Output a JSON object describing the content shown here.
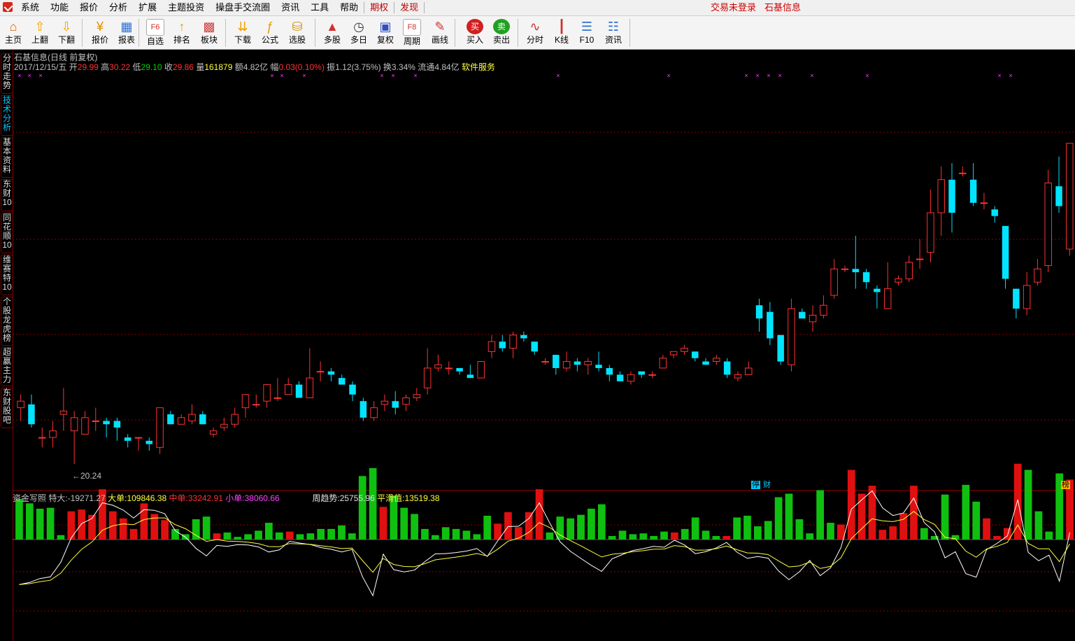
{
  "menubar": {
    "items": [
      "系统",
      "功能",
      "报价",
      "分析",
      "扩展",
      "主题投资",
      "操盘手交流圈",
      "资讯",
      "工具",
      "帮助"
    ],
    "red_items": [
      "期权",
      "发现"
    ],
    "right": [
      "交易未登录",
      "石基信息"
    ]
  },
  "toolbar": {
    "buttons": [
      {
        "label": "主页",
        "icon": "home-icon"
      },
      {
        "label": "上翻",
        "icon": "arrow-up-icon"
      },
      {
        "label": "下翻",
        "icon": "arrow-down-icon"
      },
      {
        "label": "报价",
        "icon": "yuan-icon"
      },
      {
        "label": "报表",
        "icon": "report-icon"
      },
      {
        "label": "自选",
        "icon": "f6-icon"
      },
      {
        "label": "排名",
        "icon": "ranking-icon"
      },
      {
        "label": "板块",
        "icon": "grid-icon"
      },
      {
        "label": "下载",
        "icon": "download-icon"
      },
      {
        "label": "公式",
        "icon": "formula-icon"
      },
      {
        "label": "选股",
        "icon": "stock-pick-icon"
      },
      {
        "label": "多股",
        "icon": "multi-stock-icon"
      },
      {
        "label": "多日",
        "icon": "clock-icon"
      },
      {
        "label": "复权",
        "icon": "restore-icon"
      },
      {
        "label": "周期",
        "icon": "f8-icon"
      },
      {
        "label": "画线",
        "icon": "draw-line-icon"
      },
      {
        "label": "买入",
        "icon": "buy-icon"
      },
      {
        "label": "卖出",
        "icon": "sell-icon"
      },
      {
        "label": "分时",
        "icon": "intraday-icon"
      },
      {
        "label": "K线",
        "icon": "kline-icon"
      },
      {
        "label": "F10",
        "icon": "f10-icon"
      },
      {
        "label": "资讯",
        "icon": "news-icon"
      }
    ]
  },
  "sidetabs": [
    {
      "label": "分时走势",
      "active": false
    },
    {
      "label": "技术分析",
      "active": true
    },
    {
      "label": "基本资料",
      "active": false
    },
    {
      "label": "东财10",
      "active": false
    },
    {
      "label": "同花顺10",
      "active": false
    },
    {
      "label": "维赛特10",
      "active": false
    },
    {
      "label": "个股龙虎榜",
      "active": false
    },
    {
      "label": "超赢主力",
      "active": false
    },
    {
      "label": "东财股吧",
      "active": false
    }
  ],
  "chart_title": "石基信息(日线 前复权)",
  "info": {
    "date": "2017/12/15/五",
    "open_label": "开",
    "open": "29.99",
    "high_label": "高",
    "high": "30.22",
    "low_label": "低",
    "low": "29.10",
    "close_label": "收",
    "close": "29.86",
    "vol_label": "量",
    "vol": "161879",
    "amt_label": "额",
    "amt": "4.82亿",
    "chg_label": "幅",
    "chg": "0.03(0.10%)",
    "amp_label": "振",
    "amp": "1.12(3.75%)",
    "turn_label": "换",
    "turn": "3.34%",
    "float_label": "流通",
    "float": "4.84亿",
    "service": "软件服务"
  },
  "low_mark": "←20.24",
  "tags": {
    "tag1": "停",
    "tag2": "财",
    "tag3": "榜"
  },
  "indicator": {
    "name": "资金写照",
    "tedan_label": "特大:",
    "tedan": "-19271.27",
    "dadan_label": "大单:",
    "dadan": "109846.38",
    "zhongdan_label": "中单:",
    "zhongdan": "33242.91",
    "xiaodan_label": "小单:",
    "xiaodan": "38060.66",
    "week_label": "周趋势:",
    "week": "25755.96",
    "smooth_label": "平滑值:",
    "smooth": "13519.38"
  },
  "colors": {
    "up": "#ff3232",
    "down": "#00e4ff",
    "bar_up": "#e01010",
    "bar_down": "#10c010",
    "grid": "#8a0000",
    "magenta": "#ff40ff"
  },
  "chart_data": [
    {
      "type": "candlestick",
      "title": "石基信息(日线 前复权)",
      "ylim": [
        19.5,
        32.5
      ],
      "candles": [
        [
          21.9,
          22.1,
          21.5,
          22.3
        ],
        [
          22.0,
          21.4,
          21.3,
          22.3
        ],
        [
          21.0,
          21.0,
          20.7,
          21.3
        ],
        [
          21.0,
          21.2,
          20.7,
          21.5
        ],
        [
          21.7,
          21.8,
          21.2,
          22.5
        ],
        [
          21.2,
          21.6,
          20.2,
          21.8
        ],
        [
          21.1,
          21.6,
          21.1,
          21.8
        ],
        [
          21.5,
          21.5,
          21.2,
          21.9
        ],
        [
          21.5,
          21.4,
          21.0,
          21.6
        ],
        [
          21.5,
          21.3,
          20.9,
          21.6
        ],
        [
          21.0,
          20.9,
          20.7,
          21.1
        ],
        [
          21.0,
          21.0,
          20.6,
          21.0
        ],
        [
          20.9,
          20.8,
          20.6,
          21.0
        ],
        [
          20.7,
          21.9,
          20.5,
          21.9
        ],
        [
          21.7,
          21.4,
          21.4,
          21.8
        ],
        [
          21.4,
          21.6,
          21.4,
          21.7
        ],
        [
          21.5,
          21.7,
          21.4,
          22.0
        ],
        [
          21.7,
          21.4,
          21.4,
          21.8
        ],
        [
          21.1,
          21.2,
          21.0,
          21.3
        ],
        [
          21.3,
          21.4,
          21.2,
          21.6
        ],
        [
          21.4,
          21.7,
          21.3,
          21.9
        ],
        [
          21.9,
          22.3,
          21.6,
          22.3
        ],
        [
          22.0,
          22.0,
          21.9,
          22.3
        ],
        [
          22.1,
          22.6,
          21.9,
          22.6
        ],
        [
          22.2,
          22.2,
          22.1,
          22.8
        ],
        [
          22.3,
          22.6,
          22.3,
          22.8
        ],
        [
          22.6,
          22.2,
          22.2,
          22.7
        ],
        [
          22.2,
          22.8,
          22.2,
          23.7
        ],
        [
          23.0,
          23.0,
          22.7,
          23.3
        ],
        [
          23.0,
          22.9,
          22.7,
          23.1
        ],
        [
          22.8,
          22.6,
          22.6,
          22.9
        ],
        [
          22.6,
          22.3,
          22.1,
          22.7
        ],
        [
          22.1,
          21.6,
          21.5,
          22.2
        ],
        [
          21.6,
          21.9,
          21.5,
          22.1
        ],
        [
          22.0,
          22.1,
          21.8,
          22.3
        ],
        [
          22.1,
          21.9,
          21.7,
          22.4
        ],
        [
          22.0,
          22.2,
          21.8,
          22.3
        ],
        [
          22.2,
          22.3,
          22.1,
          22.5
        ],
        [
          22.5,
          23.1,
          22.3,
          23.7
        ],
        [
          23.1,
          23.2,
          23.0,
          23.5
        ],
        [
          23.1,
          23.1,
          22.9,
          23.3
        ],
        [
          23.1,
          23.0,
          22.9,
          23.1
        ],
        [
          22.9,
          22.8,
          22.8,
          23.2
        ],
        [
          22.8,
          23.3,
          22.8,
          23.3
        ],
        [
          23.6,
          23.9,
          23.4,
          24.1
        ],
        [
          23.9,
          23.7,
          23.6,
          24.1
        ],
        [
          23.7,
          24.1,
          23.4,
          24.2
        ],
        [
          24.1,
          24.0,
          23.9,
          24.2
        ],
        [
          23.9,
          23.6,
          23.5,
          23.9
        ],
        [
          23.3,
          23.3,
          23.2,
          23.4
        ],
        [
          23.5,
          23.1,
          22.9,
          23.5
        ],
        [
          23.1,
          23.3,
          23.0,
          23.6
        ],
        [
          23.3,
          23.2,
          23.0,
          23.4
        ],
        [
          23.2,
          23.3,
          22.9,
          23.4
        ],
        [
          23.2,
          23.1,
          23.0,
          23.6
        ],
        [
          23.1,
          22.9,
          22.7,
          23.2
        ],
        [
          22.9,
          22.7,
          22.7,
          23.0
        ],
        [
          22.7,
          22.9,
          22.6,
          23.0
        ],
        [
          23.0,
          22.9,
          22.8,
          23.0
        ],
        [
          22.9,
          22.9,
          22.8,
          23.0
        ],
        [
          23.1,
          23.4,
          23.1,
          23.5
        ],
        [
          23.5,
          23.6,
          23.4,
          23.6
        ],
        [
          23.6,
          23.7,
          23.5,
          23.8
        ],
        [
          23.6,
          23.4,
          23.3,
          23.6
        ],
        [
          23.3,
          23.2,
          23.2,
          23.4
        ],
        [
          23.3,
          23.4,
          23.2,
          23.5
        ],
        [
          23.3,
          22.9,
          22.8,
          23.4
        ],
        [
          22.8,
          22.9,
          22.7,
          23.0
        ],
        [
          22.9,
          23.1,
          22.9,
          23.3
        ],
        [
          25.0,
          24.6,
          24.2,
          25.2
        ],
        [
          24.8,
          24.0,
          23.8,
          25.1
        ],
        [
          24.1,
          23.3,
          23.2,
          24.1
        ],
        [
          23.2,
          24.9,
          23.0,
          25.2
        ],
        [
          24.8,
          24.6,
          24.6,
          24.9
        ],
        [
          24.5,
          24.7,
          24.2,
          25.0
        ],
        [
          24.7,
          25.0,
          24.6,
          25.3
        ],
        [
          25.3,
          26.1,
          25.2,
          26.4
        ],
        [
          26.1,
          26.1,
          26.0,
          26.2
        ],
        [
          26.1,
          26.0,
          25.5,
          27.1
        ],
        [
          26.0,
          25.7,
          25.5,
          26.1
        ],
        [
          25.5,
          25.4,
          24.9,
          25.6
        ],
        [
          24.9,
          25.5,
          24.9,
          26.3
        ],
        [
          25.7,
          25.8,
          25.6,
          25.9
        ],
        [
          25.8,
          26.3,
          25.7,
          26.5
        ],
        [
          26.4,
          26.4,
          26.1,
          27.0
        ],
        [
          26.6,
          27.8,
          26.3,
          28.5
        ],
        [
          27.8,
          28.8,
          27.1,
          29.2
        ],
        [
          28.8,
          27.8,
          27.2,
          29.3
        ],
        [
          29.0,
          29.0,
          28.9,
          29.2
        ],
        [
          28.8,
          28.1,
          28.0,
          29.3
        ],
        [
          28.1,
          28.1,
          27.9,
          28.4
        ],
        [
          27.9,
          27.7,
          27.5,
          28.0
        ],
        [
          27.4,
          25.8,
          25.5,
          27.4
        ],
        [
          25.5,
          24.9,
          24.6,
          25.5
        ],
        [
          24.9,
          25.6,
          24.7,
          26.0
        ],
        [
          25.7,
          26.1,
          25.6,
          26.4
        ],
        [
          26.2,
          28.7,
          26.0,
          29.1
        ],
        [
          28.6,
          28.0,
          27.8,
          29.5
        ],
        [
          26.7,
          29.9,
          26.5,
          29.9
        ]
      ]
    },
    {
      "type": "bar",
      "title": "资金写照",
      "ylim": [
        -6,
        9
      ],
      "values": [
        4.6,
        4.1,
        3.5,
        3.6,
        0.5,
        3.2,
        3.4,
        2.8,
        5.7,
        3.2,
        2.4,
        1.2,
        4.1,
        2.9,
        2.2,
        1.2,
        0.6,
        2.3,
        2.6,
        0.7,
        0.8,
        0.3,
        0.6,
        1.0,
        1.9,
        0.8,
        0.9,
        0.6,
        0.7,
        1.2,
        1.2,
        1.6,
        0.7,
        7.2,
        8.1,
        3.7,
        5.0,
        3.6,
        2.9,
        1.2,
        0.5,
        1.4,
        1.2,
        1.0,
        0.6,
        2.7,
        1.8,
        3.1,
        1.4,
        3.1,
        5.7,
        0.8,
        2.6,
        2.4,
        2.8,
        3.5,
        4.0,
        0.4,
        1.0,
        0.6,
        0.7,
        0.4,
        0.9,
        0.8,
        1.2,
        2.5,
        1.0,
        0.4,
        0.4,
        2.5,
        2.7,
        1.5,
        2.1,
        4.8,
        5.2,
        2.3,
        0.7,
        5.6,
        1.9,
        1.7,
        7.9,
        5.2,
        6.1,
        1.1,
        1.5,
        3.0,
        6.1,
        1.3,
        0.4,
        5.1,
        0.5,
        6.2,
        4.3,
        2.4,
        0.4,
        1.3,
        8.6,
        7.9,
        3.2,
        0.9,
        7.5,
        6.8
      ],
      "signs": [
        -1,
        -1,
        -1,
        -1,
        -1,
        1,
        1,
        1,
        1,
        1,
        1,
        1,
        1,
        1,
        1,
        -1,
        -1,
        -1,
        -1,
        1,
        -1,
        -1,
        -1,
        -1,
        -1,
        -1,
        1,
        -1,
        -1,
        -1,
        -1,
        -1,
        -1,
        -1,
        -1,
        1,
        -1,
        -1,
        -1,
        -1,
        -1,
        -1,
        -1,
        -1,
        -1,
        -1,
        1,
        1,
        1,
        1,
        1,
        -1,
        -1,
        -1,
        -1,
        -1,
        -1,
        -1,
        -1,
        -1,
        -1,
        -1,
        -1,
        1,
        -1,
        -1,
        -1,
        -1,
        1,
        -1,
        -1,
        -1,
        -1,
        -1,
        -1,
        -1,
        -1,
        -1,
        -1,
        1,
        1,
        1,
        1,
        1,
        1,
        1,
        1,
        -1,
        -1,
        -1,
        -1,
        -1,
        -1,
        1,
        1,
        1,
        1,
        -1,
        -1,
        -1,
        -1,
        1
      ]
    }
  ]
}
